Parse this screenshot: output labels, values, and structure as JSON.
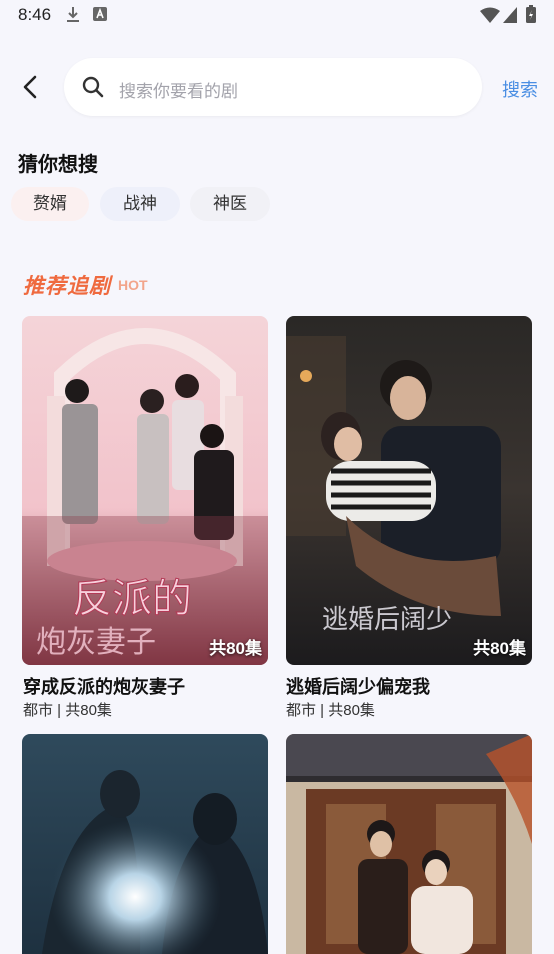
{
  "status_bar": {
    "time": "8:46"
  },
  "search": {
    "placeholder": "搜索你要看的剧",
    "button_label": "搜索"
  },
  "guess": {
    "title": "猜你想搜",
    "chips": [
      "赘婿",
      "战神",
      "神医"
    ]
  },
  "recommend": {
    "title": "推荐追剧",
    "hot_label": "HOT",
    "dramas": [
      {
        "title": "穿成反派的炮灰妻子",
        "meta": "都市 | 共80集",
        "episodes": "共80集",
        "poster_text": "反派的",
        "poster_text2": "炮灰妻子"
      },
      {
        "title": "逃婚后阔少偏宠我",
        "meta": "都市 | 共80集",
        "episodes": "共80集",
        "poster_text": "逃婚后阔少"
      },
      {
        "title": "",
        "meta": "",
        "episodes": ""
      },
      {
        "title": "",
        "meta": "",
        "episodes": ""
      }
    ]
  },
  "colors": {
    "accent": "#4a8ee3",
    "hot": "#ef6a3f",
    "background": "#f6f6fc"
  }
}
